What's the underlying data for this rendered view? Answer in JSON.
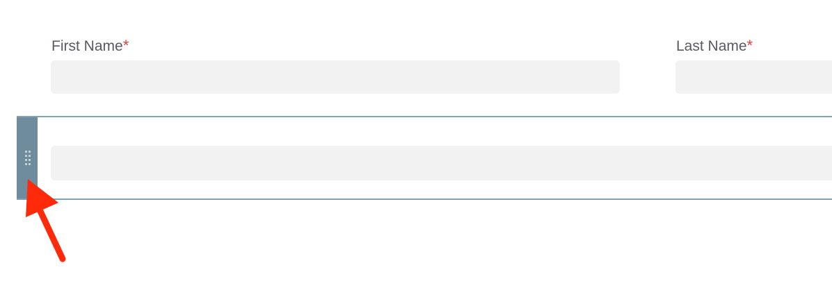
{
  "form": {
    "first_name": {
      "label": "First Name",
      "required_mark": "*",
      "value": ""
    },
    "last_name": {
      "label": "Last Name",
      "required_mark": "*",
      "value": ""
    },
    "selected_row": {
      "input_value": ""
    }
  },
  "annotation": {
    "icon": "red-arrow-icon",
    "color": "#ff2a0a"
  },
  "colors": {
    "accent": "#6f8c9c",
    "border": "#7fa0b5",
    "required": "#e53935",
    "input_bg": "#f2f2f2"
  }
}
